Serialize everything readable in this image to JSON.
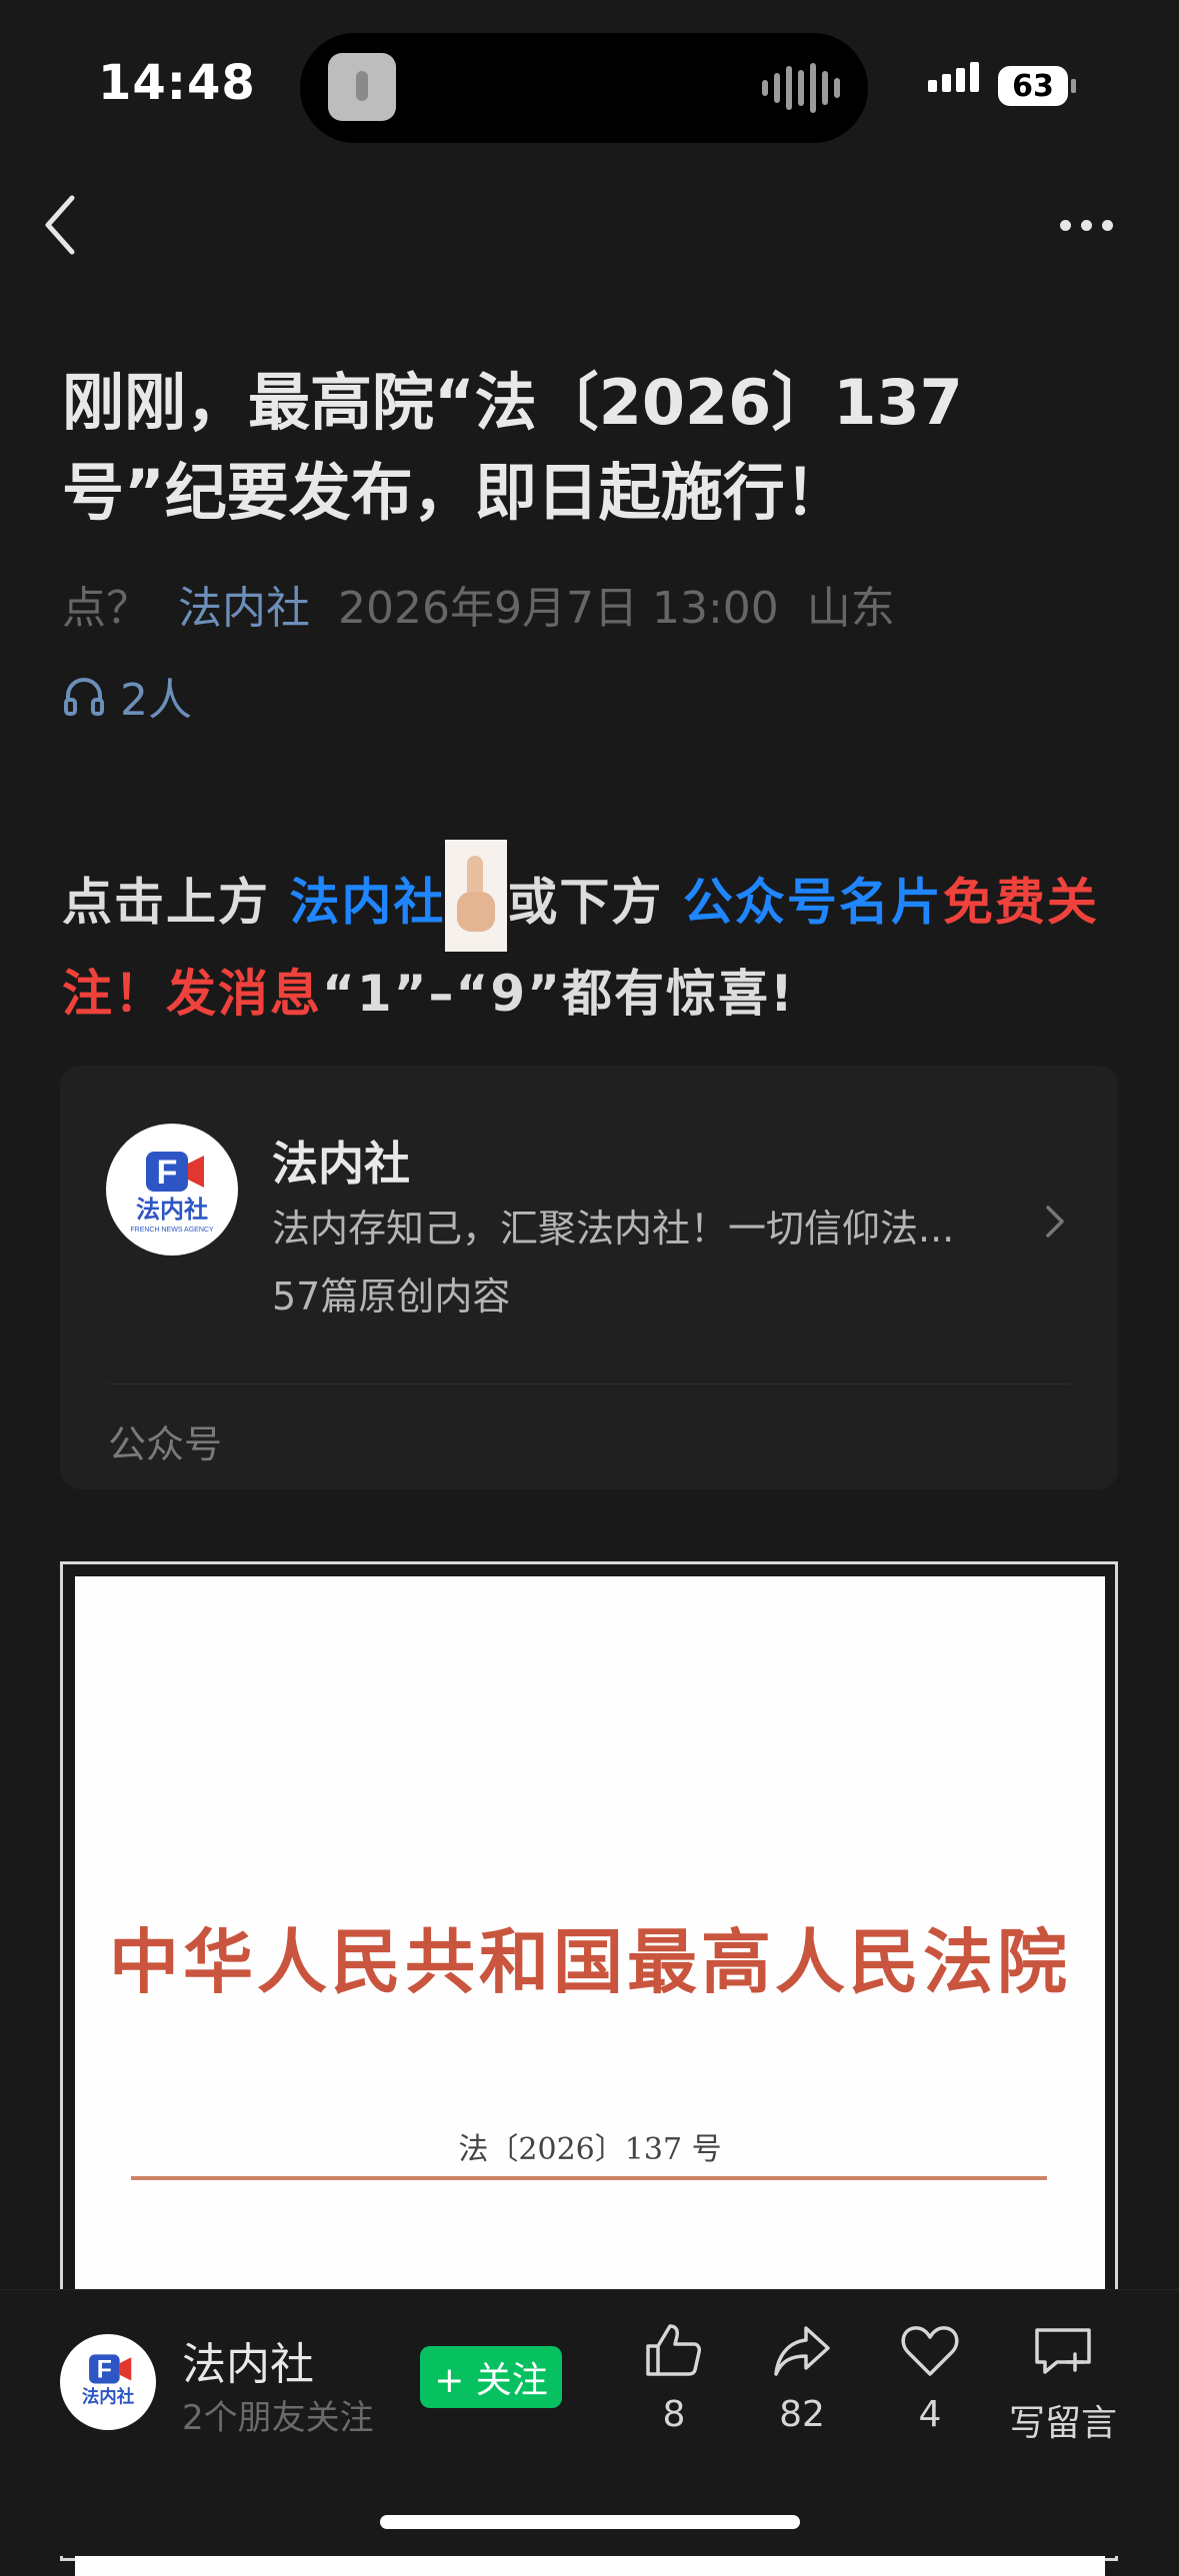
{
  "status_bar": {
    "time": "14:48",
    "battery": "63"
  },
  "nav": {
    "back_icon": "chevron-left-icon",
    "more_icon": "more-horizontal-icon"
  },
  "article": {
    "title": "刚刚，最高院“法〔2026〕137号”纪要发布，即日起施行！",
    "meta": {
      "prefix": "点？",
      "account": "法内社",
      "date": "2026年9月7日 13:00",
      "location": "山东"
    },
    "listeners": "2人"
  },
  "promo": {
    "p1": "点击上方 ",
    "p2": "法内社",
    "p3": "或下方 ",
    "p4": "公众号名片",
    "p5": "免费关注！发消息",
    "p6": "“1”–“9”都有惊喜!"
  },
  "account_card": {
    "name": "法内社",
    "description": "法内存知己，汇聚法内社！一切信仰法...",
    "original_count": "57篇原创内容",
    "footer_label": "公众号",
    "logo_text": "法内社",
    "logo_letter": "F",
    "logo_tagline": "FRENCH NEWS AGENCY"
  },
  "document_image": {
    "header": "中华人民共和国最高人民法院",
    "doc_number": "法〔2026〕137 号"
  },
  "bottom_bar": {
    "account_name": "法内社",
    "friends_follow": "2个朋友关注",
    "follow_label": "+ 关注",
    "like_count": "8",
    "share_count": "82",
    "favorite_count": "4",
    "comment_label": "写留言"
  },
  "colors": {
    "background": "#191919",
    "link_blue": "#1f86ff",
    "accent_red": "#f0423c",
    "meta_blue": "#6c8fba",
    "follow_green": "#07c160"
  }
}
